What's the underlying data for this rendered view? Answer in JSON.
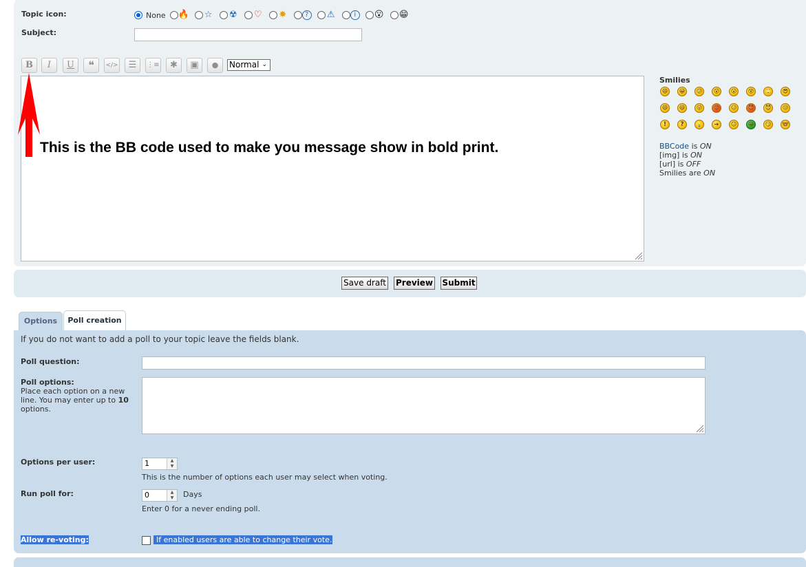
{
  "topic_icon": {
    "label": "Topic icon:",
    "none_label": "None",
    "icons": [
      "fire-icon",
      "star-icon",
      "radioactive-icon",
      "heart-icon",
      "star-burst-icon",
      "question-icon",
      "warning-icon",
      "info-icon",
      "surprised-face-icon",
      "green-grin-face-icon"
    ],
    "glyphs": [
      "🔥",
      "☆",
      "☢",
      "♡",
      "✸",
      "?",
      "⚠",
      "i",
      "😮",
      "😁"
    ],
    "selected": "None"
  },
  "subject": {
    "label": "Subject:",
    "value": ""
  },
  "toolbar": {
    "buttons": [
      {
        "name": "bold-button",
        "glyph": "B"
      },
      {
        "name": "italic-button",
        "glyph": "I"
      },
      {
        "name": "underline-button",
        "glyph": "U"
      },
      {
        "name": "quote-button",
        "glyph": "❝"
      },
      {
        "name": "code-button",
        "glyph": "</>"
      },
      {
        "name": "list-button",
        "glyph": "☰"
      },
      {
        "name": "ordered-list-button",
        "glyph": "⋮≡"
      },
      {
        "name": "list-item-button",
        "glyph": "✱"
      },
      {
        "name": "image-button",
        "glyph": "▣"
      },
      {
        "name": "color-button",
        "glyph": "●"
      }
    ],
    "font_size": "Normal"
  },
  "annotation": {
    "text": "This is the BB code used to make you message show in bold print."
  },
  "smilies": {
    "title": "Smilies",
    "rows": [
      [
        "😄",
        "😀",
        "😕",
        "😲",
        "😮",
        "😵",
        "🙄",
        "😎"
      ],
      [
        "😄",
        "😆",
        "😛",
        "😡",
        "😑",
        "😈",
        "😈",
        "😒"
      ],
      [
        "!",
        "?",
        "💡",
        "➔",
        "😐",
        "😁",
        "😏",
        "🤓"
      ]
    ]
  },
  "bbcode_status": {
    "bbcode_link": "BBCode",
    "bbcode_is": "is",
    "bbcode_state": "ON",
    "img_label": "[img] is",
    "img_state": "ON",
    "url_label": "[url] is",
    "url_state": "OFF",
    "smilies_label": "Smilies are",
    "smilies_state": "ON"
  },
  "actions": {
    "save_draft": "Save draft",
    "preview": "Preview",
    "submit": "Submit"
  },
  "tabs": [
    {
      "label": "Options"
    },
    {
      "label": "Poll creation"
    }
  ],
  "poll": {
    "intro": "If you do not want to add a poll to your topic leave the fields blank.",
    "question_label": "Poll question:",
    "question_value": "",
    "options_label": "Poll options:",
    "options_help_pre": "Place each option on a new line. You may enter up to",
    "options_help_max": "10",
    "options_help_post": "options.",
    "options_per_user_label": "Options per user:",
    "options_per_user_value": "1",
    "options_per_user_help": "This is the number of options each user may select when voting.",
    "run_for_label": "Run poll for:",
    "run_for_value": "0",
    "run_for_unit": "Days",
    "run_for_help": "Enter 0 for a never ending poll.",
    "revote_label": "Allow re-voting:",
    "revote_help": "If enabled users are able to change their vote.",
    "revote_checked": false
  }
}
